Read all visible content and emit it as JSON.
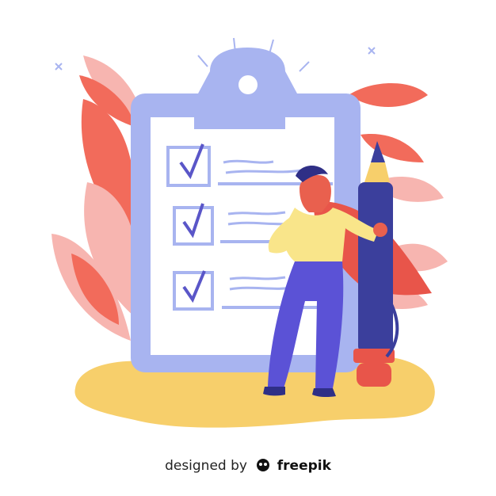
{
  "illustration": {
    "colors": {
      "clipboard": "#a8b4f0",
      "paper": "#ffffff",
      "check": "#5a56c8",
      "leaf_red": "#f26b5b",
      "leaf_pink": "#f7b5b0",
      "ground": "#f7cf6b",
      "pen": "#3b3f9c",
      "cape": "#e8554a",
      "shirt": "#f9e58a",
      "pants": "#5b52d6",
      "hair": "#2f2f86",
      "skin": "#e9604e"
    },
    "checklist_items": 3
  },
  "credit": {
    "prefix": "designed by",
    "brand": "freepik"
  }
}
